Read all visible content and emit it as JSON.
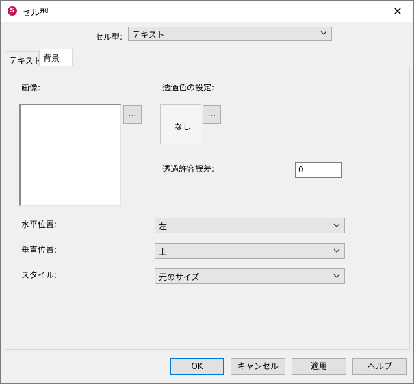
{
  "window": {
    "title": "セル型",
    "close_glyph": "✕"
  },
  "celltype": {
    "label": "セル型:",
    "selected": "テキスト"
  },
  "tabs": [
    {
      "label": "テキスト",
      "active": false
    },
    {
      "label": "背景",
      "active": true
    }
  ],
  "background": {
    "image_label": "画像:",
    "image_browse": "...",
    "transparent_label": "透過色の設定:",
    "transparent_value": "なし",
    "transparent_browse": "...",
    "tolerance_label": "透過許容誤差:",
    "tolerance_value": "0",
    "horizontal_label": "水平位置:",
    "horizontal_value": "左",
    "vertical_label": "垂直位置:",
    "vertical_value": "上",
    "style_label": "スタイル:",
    "style_value": "元のサイズ"
  },
  "buttons": {
    "ok": "OK",
    "cancel": "キャンセル",
    "apply": "適用",
    "help": "ヘルプ"
  },
  "icons": {
    "app": "app-logo-icon",
    "close": "close-icon",
    "dropdown": "chevron-down-icon"
  }
}
